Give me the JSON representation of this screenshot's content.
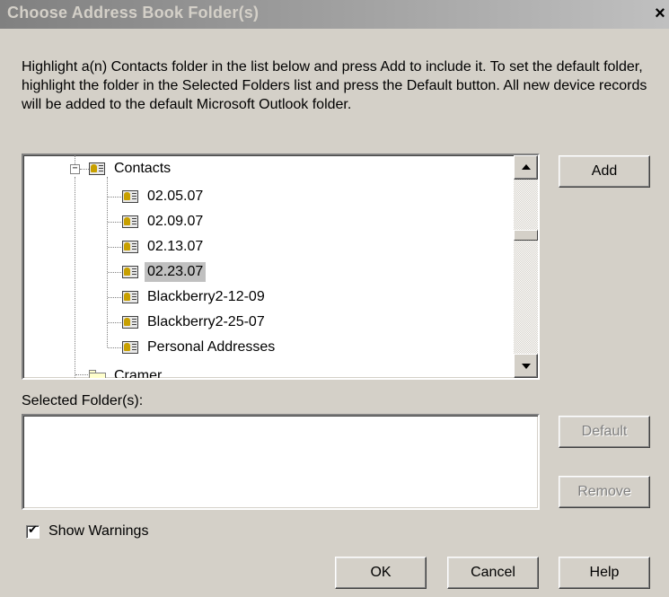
{
  "window": {
    "title": "Choose Address Book Folder(s)",
    "close_glyph": "×"
  },
  "instructions": "Highlight a(n) Contacts folder in the list below and press Add to include it.  To set the default folder, highlight the folder in the Selected Folders list and press the Default button.  All new device records will be added to the default Microsoft Outlook folder.",
  "tree": {
    "parent": {
      "label": "Contacts",
      "icon": "contacts-folder-icon",
      "expander": "−"
    },
    "items": [
      {
        "label": "02.05.07",
        "icon": "contacts-folder-icon",
        "selected": false
      },
      {
        "label": "02.09.07",
        "icon": "contacts-folder-icon",
        "selected": false
      },
      {
        "label": "02.13.07",
        "icon": "contacts-folder-icon",
        "selected": false
      },
      {
        "label": "02.23.07",
        "icon": "contacts-folder-icon",
        "selected": true
      },
      {
        "label": "Blackberry2-12-09",
        "icon": "contacts-folder-icon",
        "selected": false
      },
      {
        "label": "Blackberry2-25-07",
        "icon": "contacts-folder-icon",
        "selected": false
      },
      {
        "label": "Personal Addresses",
        "icon": "contacts-folder-icon",
        "selected": false
      }
    ],
    "partial_item": {
      "label": "Cramer",
      "icon": "folder-icon"
    }
  },
  "buttons": {
    "add": "Add",
    "default": "Default",
    "remove": "Remove",
    "ok": "OK",
    "cancel": "Cancel",
    "help": "Help"
  },
  "selected_folders": {
    "label": "Selected Folder(s):",
    "items": []
  },
  "show_warnings": {
    "label": "Show Warnings",
    "checked": true
  },
  "colors": {
    "dialog_bg": "#d4d0c8",
    "titlebar": "#808080",
    "selection_bg": "#c0c0c0",
    "disabled_text": "#808080"
  }
}
